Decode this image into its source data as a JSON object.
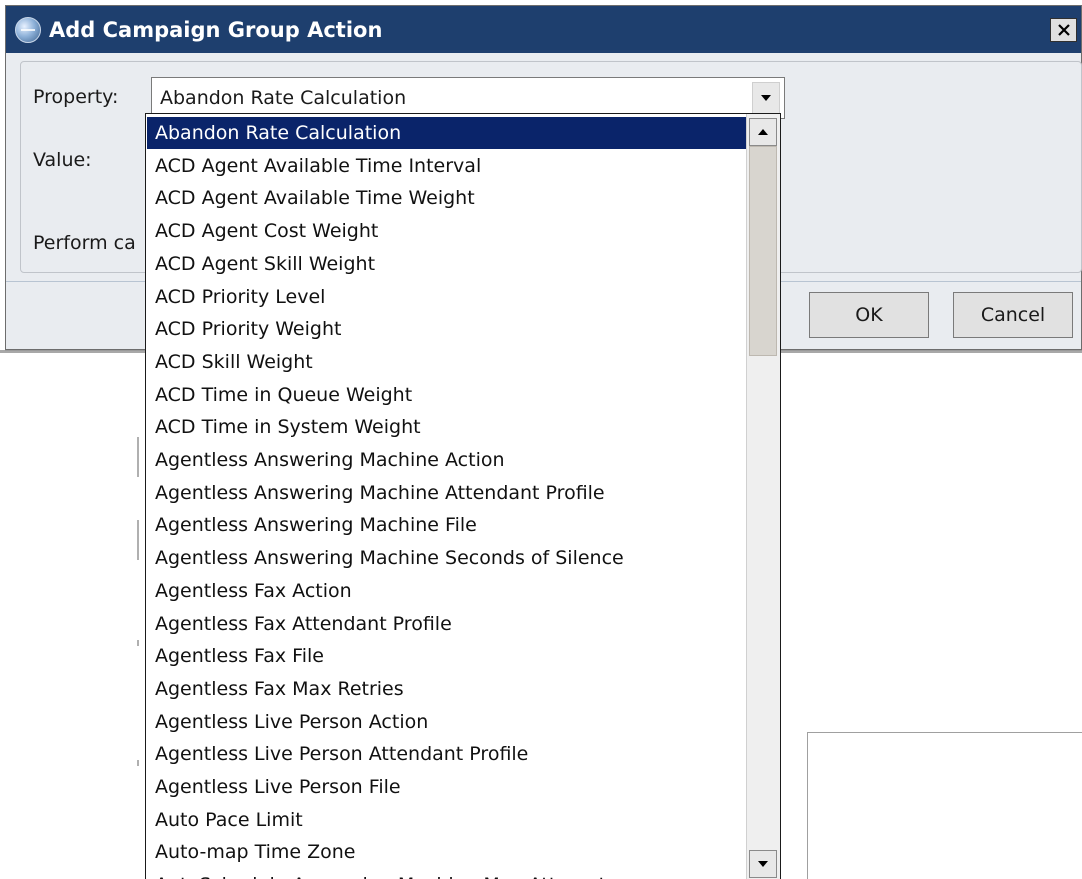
{
  "window": {
    "title": "Add Campaign Group Action",
    "icon": "globe-icon",
    "close_icon": "close-icon"
  },
  "form": {
    "property_label": "Property:",
    "property_value": "Abandon Rate Calculation",
    "value_label": "Value:",
    "perform_label": "Perform ca"
  },
  "buttons": {
    "ok": "OK",
    "cancel": "Cancel"
  },
  "dropdown": {
    "selected_index": 0,
    "options": [
      "Abandon Rate Calculation",
      "ACD Agent Available Time Interval",
      "ACD Agent Available Time Weight",
      "ACD Agent Cost Weight",
      "ACD Agent Skill Weight",
      "ACD Priority Level",
      "ACD Priority Weight",
      "ACD Skill Weight",
      "ACD Time in Queue Weight",
      "ACD Time in System Weight",
      "Agentless Answering Machine Action",
      "Agentless Answering Machine Attendant Profile",
      "Agentless Answering Machine File",
      "Agentless Answering Machine Seconds of Silence",
      "Agentless Fax Action",
      "Agentless Fax Attendant Profile",
      "Agentless Fax File",
      "Agentless Fax Max Retries",
      "Agentless Live Person Action",
      "Agentless Live Person Attendant Profile",
      "Agentless Live Person File",
      "Auto Pace Limit",
      "Auto-map Time Zone",
      "AutoSchedule Answering Machine Max Attempts"
    ]
  },
  "colors": {
    "titlebar": "#1e3f6e",
    "selection": "#0a246a",
    "dialog_bg": "#e9ecf0"
  }
}
